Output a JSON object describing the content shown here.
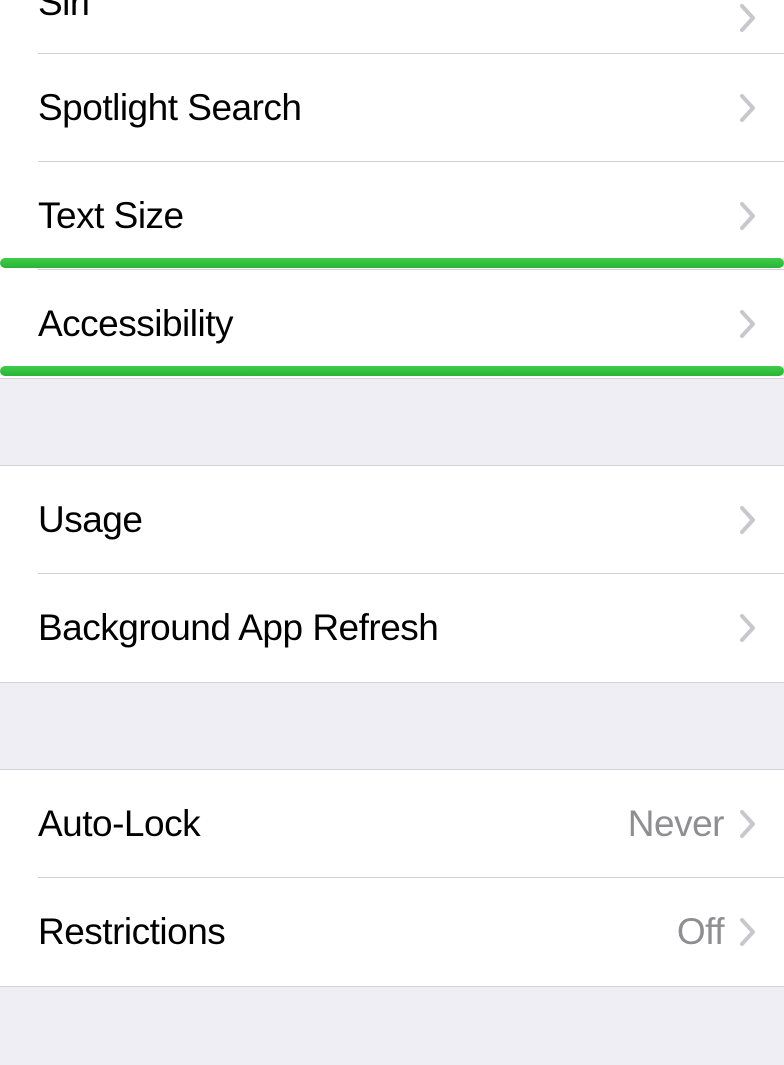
{
  "group1": {
    "items": [
      {
        "label": "Siri",
        "value": ""
      },
      {
        "label": "Spotlight Search",
        "value": ""
      },
      {
        "label": "Text Size",
        "value": ""
      },
      {
        "label": "Accessibility",
        "value": ""
      }
    ]
  },
  "group2": {
    "items": [
      {
        "label": "Usage",
        "value": ""
      },
      {
        "label": "Background App Refresh",
        "value": ""
      }
    ]
  },
  "group3": {
    "items": [
      {
        "label": "Auto-Lock",
        "value": "Never"
      },
      {
        "label": "Restrictions",
        "value": "Off"
      }
    ]
  },
  "annotation": {
    "color": "#2fbf3b"
  }
}
